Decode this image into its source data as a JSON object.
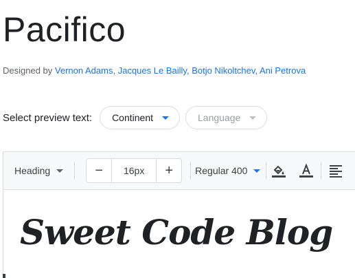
{
  "font": {
    "name": "Pacifico",
    "designed_by_label": "Designed by",
    "designers": [
      "Vernon Adams",
      "Jacques Le Bailly",
      "Botjo Nikoltchev",
      "Ani Petrova"
    ],
    "separator": ","
  },
  "preview_controls": {
    "label": "Select preview text:",
    "continent": "Continent",
    "language": "Language"
  },
  "toolbar": {
    "style": "Heading",
    "size": "16px",
    "decrease": "−",
    "increase": "+",
    "weight": "Regular 400",
    "icons": [
      "fill-color-icon",
      "text-color-icon",
      "align-left-icon"
    ]
  },
  "preview": {
    "text": "Sweet Code Blog"
  },
  "colors": {
    "link": "#1a73e8",
    "text": "#202124",
    "border": "#dadce0",
    "toolbar_bg": "#f8f9fa"
  }
}
